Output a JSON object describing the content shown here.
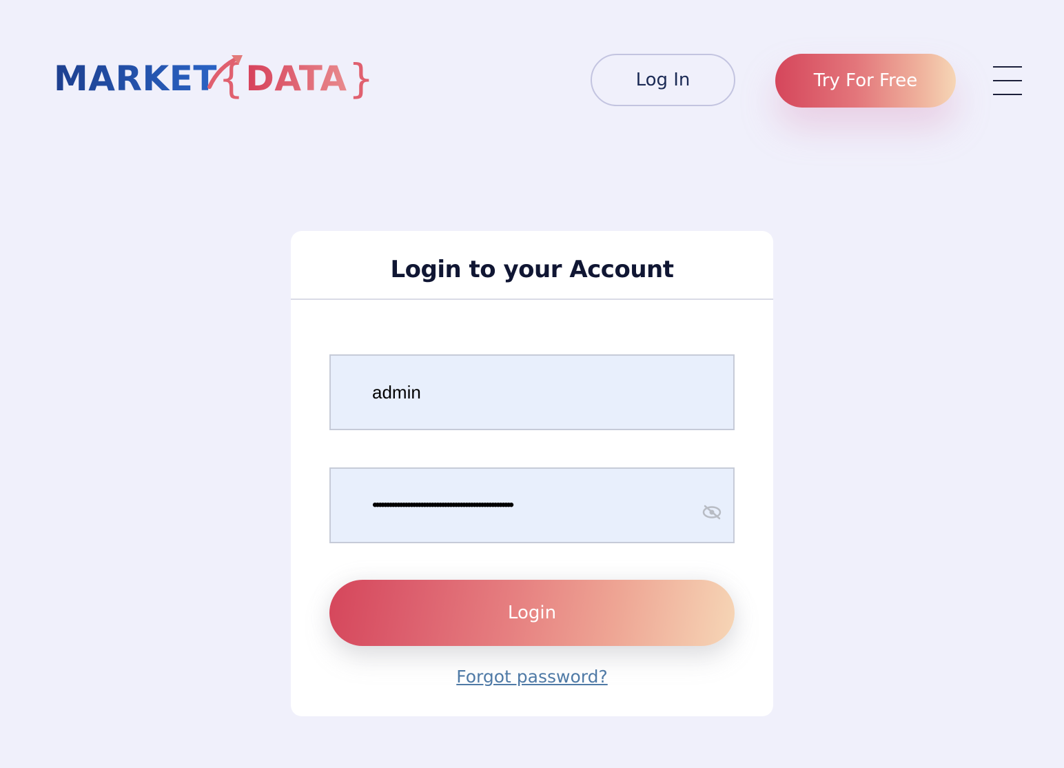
{
  "header": {
    "logo": {
      "word_market": "MARKET",
      "brace_open": "{",
      "word_data": "DATA",
      "brace_close": "}"
    },
    "login_label": "Log In",
    "try_label": "Try For Free",
    "menu_icon": "hamburger-menu-icon"
  },
  "form": {
    "title": "Login to your Account",
    "username_value": "admin",
    "password_masked": "•••••••••••••••••••••••••••••••••••••••••••••••••••••",
    "password_toggle_icon": "eye-slash-icon",
    "submit_label": "Login",
    "forgot_label": "Forgot password?"
  },
  "colors": {
    "background": "#f0f0fb",
    "brand_blue": "#1f4fa8",
    "brand_red": "#d9475e",
    "gradient_start": "#d5465b",
    "gradient_end": "#f6d6b6",
    "link": "#4f7aa6"
  }
}
